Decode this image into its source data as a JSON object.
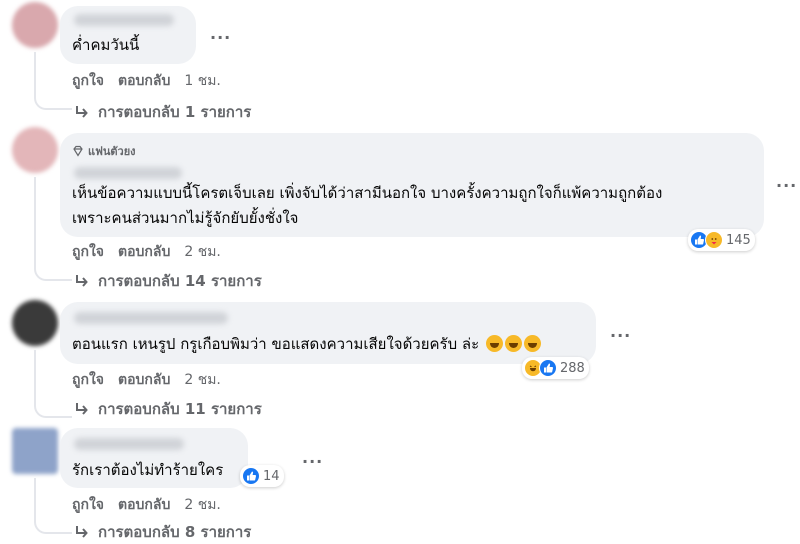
{
  "comments": [
    {
      "text_lines": [
        "ค่ำคมวันนี้"
      ],
      "like_label": "ถูกใจ",
      "reply_label": "ตอบกลับ",
      "time": "1 ชม.",
      "replies_label": "การตอบกลับ 1 รายการ",
      "avatar_color": "#d9a8ad"
    },
    {
      "badge": "แฟนตัวยง",
      "text_lines": [
        "เห็นข้อความแบบนี้โครตเจ็บเลย เพิ่งจับได้ว่าสามีนอกใจ บางครั้งความถูกใจก็แพ้ความถูกต้อง",
        "เพราะคนส่วนมากไม่รู้จักยับยั้งชั่งใจ"
      ],
      "like_label": "ถูกใจ",
      "reply_label": "ตอบกลับ",
      "time": "2 ชม.",
      "replies_label": "การตอบกลับ 14 รายการ",
      "reaction_count": "145",
      "avatar_color": "#e3b6b9"
    },
    {
      "text_lines": [
        "ตอนแรก เหนรูป กรูเกือบพิมว่า ขอแสดงความเสียใจด้วยครับ ล่ะ"
      ],
      "like_label": "ถูกใจ",
      "reply_label": "ตอบกลับ",
      "time": "2 ชม.",
      "replies_label": "การตอบกลับ 11 รายการ",
      "reaction_count": "288",
      "avatar_color": "#3a3a3a"
    },
    {
      "text_lines": [
        "รักเราต้องไม่ทำร้ายใคร"
      ],
      "like_label": "ถูกใจ",
      "reply_label": "ตอบกลับ",
      "time": "2 ชม.",
      "replies_label": "การตอบกลับ 8 รายการ",
      "reaction_count": "14",
      "avatar_color": "#8ea3c9"
    }
  ],
  "more_label": "···",
  "colors": {
    "like_blue": "#1877f2",
    "haha_yellow": "#f7b928",
    "bubble": "#f0f2f5",
    "meta_gray": "#65676b"
  }
}
